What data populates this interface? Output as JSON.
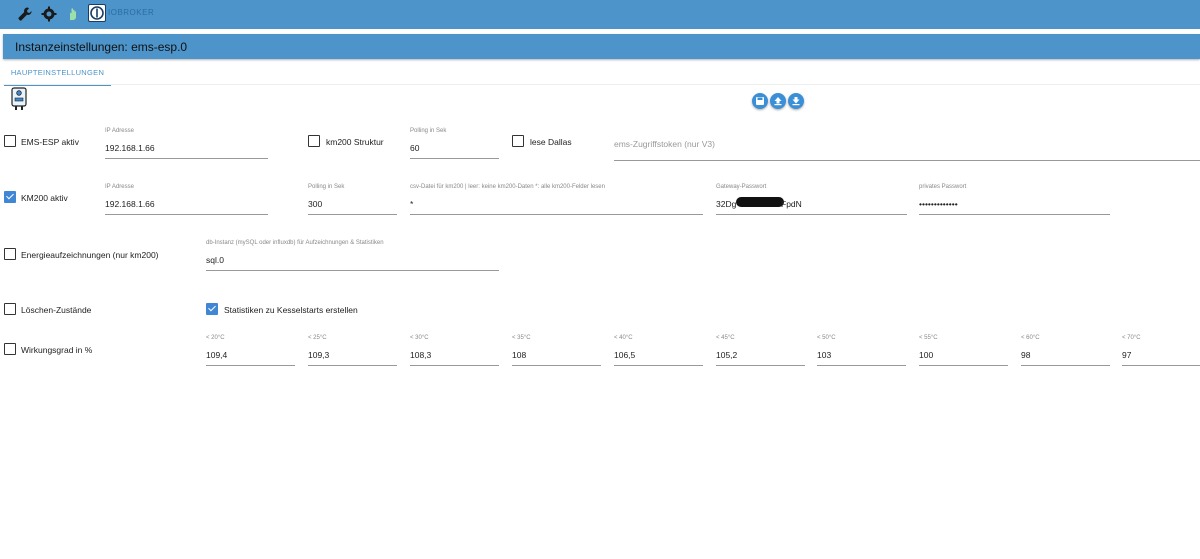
{
  "topbar": {
    "brand": "IOBROKER",
    "icons": [
      "wrench-icon",
      "gear-icon",
      "hand-icon",
      "iobroker-logo-icon"
    ]
  },
  "page_title": "Instanzeinstellungen: ems-esp.0",
  "tabs": [
    {
      "label": "HAUPTEINSTELLUNGEN",
      "active": true
    }
  ],
  "toolbar": {
    "buttons": [
      "save-icon",
      "upload-icon",
      "download-icon"
    ]
  },
  "colors": {
    "header": "#4c94c9",
    "accent": "#3f87d5"
  },
  "row1": {
    "ems_esp": {
      "label": "EMS-ESP aktiv",
      "checked": false
    },
    "ip": {
      "label": "IP Adresse",
      "value": "192.168.1.66"
    },
    "km200_struktur": {
      "label": "km200 Struktur",
      "checked": false
    },
    "polling": {
      "label": "Polling in Sek",
      "value": "60"
    },
    "lese_dallas": {
      "label": "lese Dallas",
      "checked": false
    },
    "token": {
      "placeholder": "ems-Zugriffstoken (nur V3)"
    }
  },
  "row2": {
    "km200": {
      "label": "KM200 aktiv",
      "checked": true
    },
    "ip": {
      "label": "IP Adresse",
      "value": "192.168.1.66"
    },
    "polling": {
      "label": "Polling in Sek",
      "value": "300"
    },
    "csv": {
      "label": "csv-Datei für km200 | leer: keine km200-Daten *: alle km200-Felder lesen",
      "value": "*"
    },
    "gateway": {
      "label": "Gateway-Passwort",
      "value_start": "32Dg",
      "value_end": "FpdN"
    },
    "private": {
      "label": "privates Passwort",
      "value": "•••••••••••••"
    }
  },
  "row3": {
    "energie": {
      "label": "Energieaufzeichnungen (nur km200)",
      "checked": false
    },
    "db": {
      "label": "db-Instanz (mySQL oder influxdb) für Aufzeichnungen & Statistiken",
      "value": "sql.0"
    }
  },
  "row4": {
    "loeschen": {
      "label": "Löschen-Zustände",
      "checked": false
    },
    "statistiken": {
      "label": "Statistiken zu Kesselstarts erstellen",
      "checked": true
    }
  },
  "row5": {
    "wirkungsgrad": {
      "label": "Wirkungsgrad in %",
      "checked": false
    },
    "temps": [
      {
        "label": "< 20°C",
        "value": "109,4"
      },
      {
        "label": "< 25°C",
        "value": "109,3"
      },
      {
        "label": "< 30°C",
        "value": "108,3"
      },
      {
        "label": "< 35°C",
        "value": "108"
      },
      {
        "label": "< 40°C",
        "value": "106,5"
      },
      {
        "label": "< 45°C",
        "value": "105,2"
      },
      {
        "label": "< 50°C",
        "value": "103"
      },
      {
        "label": "< 55°C",
        "value": "100"
      },
      {
        "label": "< 60°C",
        "value": "98"
      },
      {
        "label": "< 70°C",
        "value": "97"
      }
    ]
  }
}
